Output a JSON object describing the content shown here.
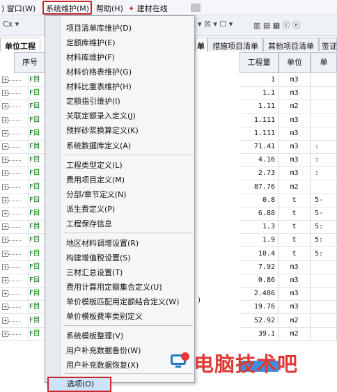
{
  "menubar": {
    "items": [
      "窗口(W)",
      "系统维护(M)",
      "帮助(H)",
      "建材在线"
    ],
    "window": ") 窗口(W)",
    "system": "系统维护(M)",
    "help": "帮助(H)",
    "jiancai": "建材在线"
  },
  "toolbar": {
    "cx": "Cx ▾",
    "t1": "▾ ☒ ▾ ☐ ▾",
    "t2": "▥ ▤ ▦ ⓣ ⓔ"
  },
  "tabs": {
    "left": "单位工程",
    "right1": "单",
    "right2": "措施项目清单",
    "right3": "其他项目清单",
    "right4": "签证"
  },
  "grid": {
    "header_seq": "序号",
    "header_qty": "工程量",
    "header_unit": "单位",
    "header_price": "单",
    "code_prefix": "F目",
    "rows": [
      {
        "qty": "1",
        "unit": "m3",
        "price": ""
      },
      {
        "qty": "1.1",
        "unit": "m3",
        "price": ""
      },
      {
        "qty": "1.11",
        "unit": "m2",
        "price": ""
      },
      {
        "qty": "1.111",
        "unit": "m3",
        "price": ""
      },
      {
        "qty": "1.111",
        "unit": "m3",
        "price": ""
      },
      {
        "qty": "71.41",
        "unit": "m3",
        "price": ":"
      },
      {
        "qty": "4.16",
        "unit": "m3",
        "price": ":"
      },
      {
        "qty": "2.73",
        "unit": "m3",
        "price": ":"
      },
      {
        "qty": "87.76",
        "unit": "m2",
        "price": ""
      },
      {
        "qty": "0.8",
        "unit": "t",
        "price": "5-"
      },
      {
        "qty": "6.88",
        "unit": "t",
        "price": "5-"
      },
      {
        "qty": "1.3",
        "unit": "t",
        "price": "5:"
      },
      {
        "qty": "1.9",
        "unit": "t",
        "price": "5:"
      },
      {
        "qty": "10.4",
        "unit": "t",
        "price": "5:"
      },
      {
        "qty": "7.92",
        "unit": "m3",
        "price": ""
      },
      {
        "qty": "0.86",
        "unit": "m3",
        "price": ""
      },
      {
        "qty": "2.486",
        "unit": "m3",
        "price": ""
      },
      {
        "qty": "19.76",
        "unit": "m3",
        "price": ""
      },
      {
        "qty": "52.92",
        "unit": "m2",
        "price": ""
      },
      {
        "qty": "39.1",
        "unit": "m2",
        "price": ""
      }
    ],
    "paren": ")"
  },
  "dropdown": {
    "items": [
      "项目清单库维护(D)",
      "定额库维护(E)",
      "材料库维护(F)",
      "材料价格表维护(G)",
      "材料比重表维护(H)",
      "定额指引维护(I)",
      "关联定额录入定义(J)",
      "预拌砂浆换算定义(K)",
      "系统数据库定义(A)",
      "工程类型定义(L)",
      "费用项目定义(M)",
      "分部/章节定义(N)",
      "派生费定义(P)",
      "工程保存信息",
      "地区材料调增设置(R)",
      "构建增值税设置(S)",
      "三材汇总设置(T)",
      "费用计算用定额集合定义(U)",
      "单价模板匹配用定额结合定义(W)",
      "单价模板费率类别定义",
      "系统模板整理(V)",
      "用户补充数据备份(W)",
      "用户补充数据恢复(X)",
      "选项(O)"
    ]
  },
  "watermark": {
    "text": "电脑技术吧"
  },
  "colors": {
    "highlight_border": "#c8252d",
    "selected_cell": "#3a8fe0",
    "watermark": "#e03a36",
    "code_green": "#007a00"
  }
}
